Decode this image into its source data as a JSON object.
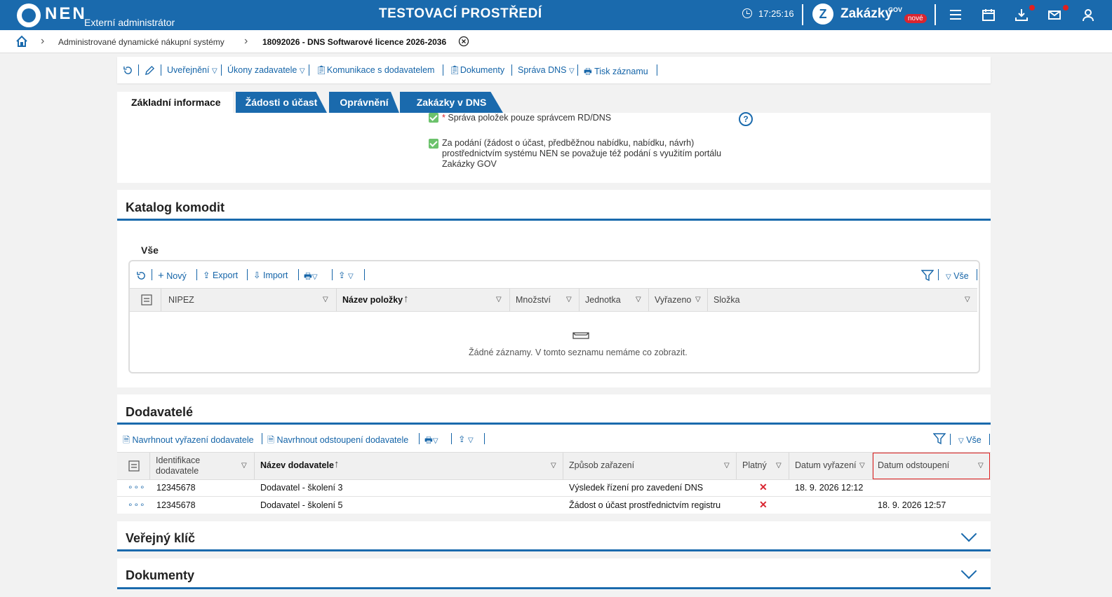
{
  "header": {
    "logo": "NEN",
    "user_role": "Externí administrátor",
    "environment": "TESTOVACÍ PROSTŘEDÍ",
    "time": "17:25:16",
    "zakazky": "Zakázky",
    "zakazky_sup": "GOV",
    "zakazky_badge": "nové"
  },
  "breadcrumb": {
    "item1": "Administrované dynamické nákupní systémy",
    "item2": "18092026 - DNS Softwarové licence 2026-2036"
  },
  "toolbar": {
    "publish": "Uveřejnění",
    "actions": "Úkony zadavatele",
    "communication": "Komunikace s dodavatelem",
    "documents": "Dokumenty",
    "dns_admin": "Správa DNS",
    "print": "Tisk záznamu"
  },
  "tabs": [
    "Základní informace",
    "Žádosti o účast",
    "Oprávnění",
    "Zakázky v DNS"
  ],
  "basic_info": {
    "check1_asterisk": "*",
    "check1": "Správa položek pouze správcem RD/DNS",
    "check2_line1": "Za podání (žádost o účast, předběžnou nabídku, nabídku, návrh)",
    "check2_line2": "prostřednictvím systému NEN se považuje též podání s využitím portálu",
    "check2_line3": "Zakázky GOV",
    "help": "?"
  },
  "catalog": {
    "title": "Katalog komodit",
    "subtab": "Vše",
    "toolbar": {
      "new": "Nový",
      "export": "Export",
      "import": "Import",
      "all": "Vše"
    },
    "columns": [
      "NIPEZ",
      "Název položky",
      "Množství",
      "Jednotka",
      "Vyřazeno",
      "Složka"
    ],
    "empty_message": "Žádné záznamy. V tomto seznamu nemáme co zobrazit."
  },
  "suppliers": {
    "title": "Dodavatelé",
    "toolbar": {
      "propose_exclusion": "Navrhnout vyřazení dodavatele",
      "propose_withdrawal": "Navrhnout odstoupení dodavatele",
      "all": "Vše"
    },
    "columns": {
      "id_line1": "Identifikace",
      "id_line2": "dodavatele",
      "name": "Název dodavatele",
      "method": "Způsob zařazení",
      "valid": "Platný",
      "excluded_date": "Datum vyřazení",
      "withdrawal_date": "Datum odstoupení"
    },
    "rows": [
      {
        "id": "12345678",
        "name": "Dodavatel - školení 3",
        "method": "Výsledek řízení pro zavedení DNS",
        "valid": "✕",
        "excluded_date": "18. 9. 2026 12:12",
        "withdrawal_date": ""
      },
      {
        "id": "12345678",
        "name": "Dodavatel - školení 5",
        "method": "Žádost o účast prostřednictvím registru",
        "valid": "✕",
        "excluded_date": "",
        "withdrawal_date": "18. 9. 2026 12:57"
      }
    ]
  },
  "public_key": {
    "title": "Veřejný klíč"
  },
  "documents": {
    "title": "Dokumenty"
  }
}
